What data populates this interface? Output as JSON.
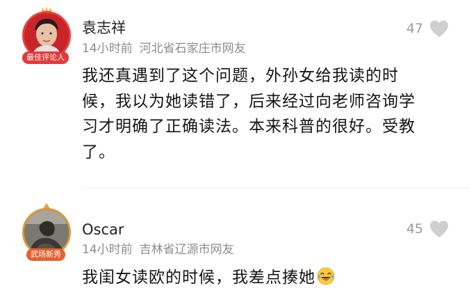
{
  "comments": [
    {
      "username": "袁志祥",
      "time": "14小时前",
      "location": "河北省石家庄市网友",
      "badge": "最佳评论人",
      "likes": "47",
      "text": "我还真遇到了这个问题，外孙女给我读的时候，我以为她读错了，后来经过向老师咨询学习才明确了正确读法。本来科普的很好。受教了。"
    },
    {
      "username": "Oscar",
      "time": "14小时前",
      "location": "吉林省辽源市网友",
      "badge": "武场新秀",
      "likes": "45",
      "text": "我闺女读欧的时候，我差点揍她"
    }
  ],
  "colors": {
    "like_gray": "#cfcfcf",
    "badge_red": "#e33a3a",
    "badge_orange": "#e5602f",
    "meta_gray": "#8c8c8c"
  },
  "icons": {
    "like": "heart-icon",
    "emoji": "laughing-tears-emoji-icon"
  }
}
